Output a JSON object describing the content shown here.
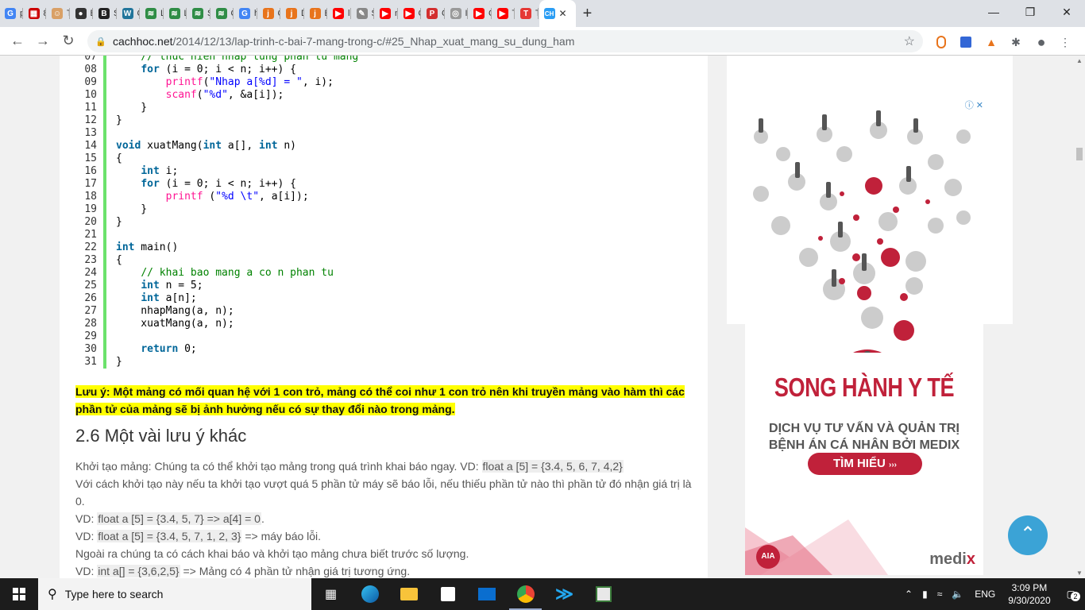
{
  "browser": {
    "tabs": [
      {
        "label": "pl",
        "icon": "google-icon",
        "color": "#4285f4",
        "glyph": "G"
      },
      {
        "label": "8.",
        "icon": "tin-hoc-icon",
        "color": "#c00",
        "glyph": "▦"
      },
      {
        "label": "Tá",
        "icon": "avatar-icon",
        "color": "#d9a066",
        "glyph": "☺"
      },
      {
        "label": "B",
        "icon": "github-icon",
        "color": "#333",
        "glyph": "●"
      },
      {
        "label": "Sí",
        "icon": "bmtab-icon",
        "color": "#222",
        "glyph": "B"
      },
      {
        "label": "C",
        "icon": "wordpress-icon",
        "color": "#21759b",
        "glyph": "W"
      },
      {
        "label": "Li",
        "icon": "gfg-icon",
        "color": "#2f8d46",
        "glyph": "≋"
      },
      {
        "label": "Li",
        "icon": "gfg-icon",
        "color": "#2f8d46",
        "glyph": "≋"
      },
      {
        "label": "Sí",
        "icon": "gfg-icon",
        "color": "#2f8d46",
        "glyph": "≋"
      },
      {
        "label": "C",
        "icon": "gfg-icon",
        "color": "#2f8d46",
        "glyph": "≋"
      },
      {
        "label": "h",
        "icon": "google-icon",
        "color": "#4285f4",
        "glyph": "G"
      },
      {
        "label": "C",
        "icon": "j-icon",
        "color": "#e8741c",
        "glyph": "j"
      },
      {
        "label": "D",
        "icon": "j-icon",
        "color": "#e8741c",
        "glyph": "j"
      },
      {
        "label": "É",
        "icon": "j-icon",
        "color": "#e8741c",
        "glyph": "j"
      },
      {
        "label": "lị",
        "icon": "youtube-icon",
        "color": "#ff0000",
        "glyph": "▶"
      },
      {
        "label": "S",
        "icon": "tool-icon",
        "color": "#888",
        "glyph": "✎"
      },
      {
        "label": "n",
        "icon": "youtube-icon",
        "color": "#ff0000",
        "glyph": "▶"
      },
      {
        "label": "C",
        "icon": "youtube-icon",
        "color": "#ff0000",
        "glyph": "▶"
      },
      {
        "label": "C",
        "icon": "pdf-icon",
        "color": "#d32f2f",
        "glyph": "P"
      },
      {
        "label": "IT",
        "icon": "it-icon",
        "color": "#999",
        "glyph": "◎"
      },
      {
        "label": "C",
        "icon": "youtube-icon",
        "color": "#ff0000",
        "glyph": "▶"
      },
      {
        "label": "Te",
        "icon": "youtube-icon",
        "color": "#ff0000",
        "glyph": "▶"
      },
      {
        "label": "Tr",
        "icon": "t-icon",
        "color": "#e53935",
        "glyph": "T"
      }
    ],
    "active_tab": {
      "label": "",
      "glyph": "CH",
      "color": "#2a9df4"
    },
    "url_host": "cachhoc.net",
    "url_path": "/2014/12/13/lap-trinh-c-bai-7-mang-trong-c/#25_Nhap_xuat_mang_su_dung_ham"
  },
  "code_lines": [
    {
      "n": "07",
      "html": "    <span class=\"cm\">// thuc hien nhap tung phan tu mang</span>"
    },
    {
      "n": "08",
      "html": "    <span class=\"kw\">for</span> (i = 0; i &lt; n; i++) {"
    },
    {
      "n": "09",
      "html": "        <span class=\"fn\">printf</span>(<span class=\"st\">\"Nhap a[%d] = \"</span>, i);"
    },
    {
      "n": "10",
      "html": "        <span class=\"fn\">scanf</span>(<span class=\"st\">\"%d\"</span>, &amp;a[i]);"
    },
    {
      "n": "11",
      "html": "    }"
    },
    {
      "n": "12",
      "html": "}"
    },
    {
      "n": "13",
      "html": ""
    },
    {
      "n": "14",
      "html": "<span class=\"kw\">void</span> xuatMang(<span class=\"kw\">int</span> a[], <span class=\"kw\">int</span> n)"
    },
    {
      "n": "15",
      "html": "{"
    },
    {
      "n": "16",
      "html": "    <span class=\"kw\">int</span> i;"
    },
    {
      "n": "17",
      "html": "    <span class=\"kw\">for</span> (i = 0; i &lt; n; i++) {"
    },
    {
      "n": "18",
      "html": "        <span class=\"fn\">printf</span> (<span class=\"st\">\"%d \\t\"</span>, a[i]);"
    },
    {
      "n": "19",
      "html": "    }"
    },
    {
      "n": "20",
      "html": "}"
    },
    {
      "n": "21",
      "html": ""
    },
    {
      "n": "22",
      "html": "<span class=\"kw\">int</span> main()"
    },
    {
      "n": "23",
      "html": "{"
    },
    {
      "n": "24",
      "html": "    <span class=\"cm\">// khai bao mang a co n phan tu</span>"
    },
    {
      "n": "25",
      "html": "    <span class=\"kw\">int</span> n = 5;"
    },
    {
      "n": "26",
      "html": "    <span class=\"kw\">int</span> a[n];"
    },
    {
      "n": "27",
      "html": "    nhapMang(a, n);"
    },
    {
      "n": "28",
      "html": "    xuatMang(a, n);"
    },
    {
      "n": "29",
      "html": ""
    },
    {
      "n": "30",
      "html": "    <span class=\"kw\">return</span> 0;"
    },
    {
      "n": "31",
      "html": "}"
    }
  ],
  "article": {
    "note": "Lưu ý: Một mảng có mối quan hệ với 1 con trỏ, mảng có thể coi như 1 con trỏ nên khi truyền mảng vào hàm thì các phần tử của mảng sẽ bị ảnh hưởng nếu có sự thay đổi nào trong mảng.",
    "heading": "2.6 Một vài lưu ý khác",
    "p1_text": "Khởi tạo mảng: Chúng ta có thể khởi tạo mảng trong quá trình khai báo ngay. VD: ",
    "p1_code": "float a [5] = {3.4, 5, 6, 7, 4,2}",
    "p2": "Với cách khởi tạo này nếu ta khởi tạo vượt quá 5 phần tử máy sẽ báo lỗi, nếu thiếu phần tử nào thì phần tử đó nhận giá trị là 0.",
    "p3_text": "VD: ",
    "p3_code": "float a [5] = {3.4, 5, 7} => a[4] = 0",
    "p3_end": ".",
    "p4_text": "VD: ",
    "p4_code": "float a [5] = {3.4, 5, 7, 1, 2, 3}",
    "p4_end": " => máy báo lỗi.",
    "p5": "Ngoài ra chúng ta có cách khai báo và khởi tạo mảng chưa biết trước số lượng.",
    "p6_text": "VD: ",
    "p6_code": "int a[] = {3,6,2,5}",
    "p6_end": " => Mảng có 4 phần tử nhận giá trị tương ứng."
  },
  "ad": {
    "title": "SONG HÀNH Y TẾ",
    "sub1": "DỊCH VỤ TƯ VẤN VÀ QUẢN TRỊ",
    "sub2": "BỆNH ÁN CÁ NHÂN BỞI MEDIX",
    "cta": "TÌM HIỂU",
    "brand_a": "medi",
    "brand_b": "x",
    "aia": "AIA"
  },
  "taskbar": {
    "search_placeholder": "Type here to search",
    "lang": "ENG",
    "time": "3:09 PM",
    "date": "9/30/2020",
    "notif_count": "2"
  }
}
